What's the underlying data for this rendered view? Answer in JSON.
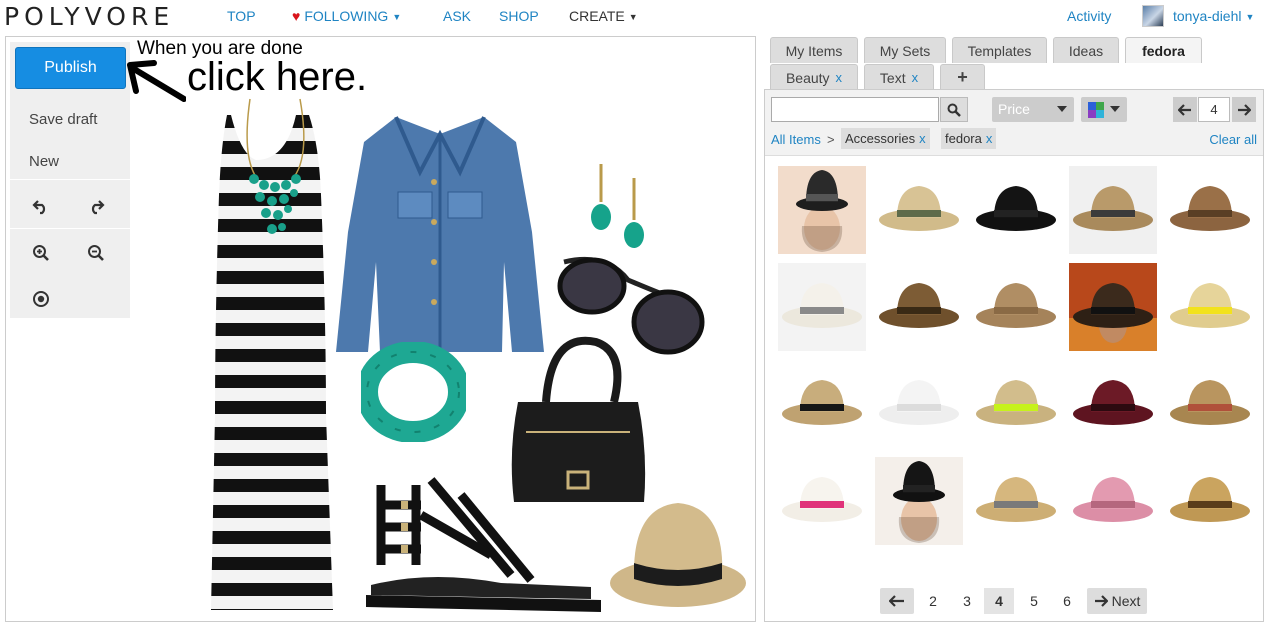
{
  "nav": {
    "logo": "POLYVORE",
    "items": [
      {
        "label": "TOP"
      },
      {
        "label": "FOLLOWING"
      },
      {
        "label": "ASK"
      },
      {
        "label": "SHOP"
      },
      {
        "label": "CREATE"
      }
    ],
    "activity": "Activity",
    "username": "tonya-diehl",
    "colors": {
      "link": "#1f84c3",
      "heart": "#d9141b"
    }
  },
  "toolbox": {
    "publish": "Publish",
    "save_draft": "Save draft",
    "new": "New",
    "icons": [
      "undo-icon",
      "redo-icon",
      "zoom-in-icon",
      "zoom-out-icon",
      "target-icon"
    ]
  },
  "hint": {
    "small": "When you are done",
    "big": "click here."
  },
  "canvas_items": [
    "striped-maxi-dress",
    "statement-necklace",
    "denim-jacket",
    "turquoise-earrings",
    "aviator-sunglasses",
    "turquoise-bracelet",
    "black-leather-bag",
    "black-gladiator-sandals",
    "straw-fedora"
  ],
  "tabs": {
    "row1": [
      {
        "label": "My Items"
      },
      {
        "label": "My Sets"
      },
      {
        "label": "Templates"
      },
      {
        "label": "Ideas"
      },
      {
        "label": "fedora",
        "active": true
      }
    ],
    "row2": [
      {
        "label": "Beauty",
        "close": "x"
      },
      {
        "label": "Text",
        "close": "x"
      },
      {
        "label": "+"
      }
    ]
  },
  "search": {
    "value": "",
    "price_label": "Price",
    "page_value": "4"
  },
  "breadcrumb": {
    "all": "All Items",
    "sep": ">",
    "chip1": "Accessories",
    "chip2": "fedora",
    "chip_close": "x",
    "clear": "Clear all"
  },
  "results": [
    "fedora-on-model",
    "straw-fedora-green-band",
    "black-wool-fedora",
    "tan-fedora",
    "brown-fedora",
    "white-fedora",
    "small-brown-fedora",
    "woven-straw-fedora",
    "indiana-jones-poster",
    "yellow-band-straw-fedora",
    "straw-fedora-black-band",
    "white-ribbed-fedora",
    "neon-band-straw-fedora",
    "burgundy-wide-brim-hat",
    "patterned-band-fedora",
    "white-pink-band-panama",
    "black-hat-on-model",
    "straw-gray-band-fedora",
    "pink-floppy-hat",
    "natural-straw-fedora"
  ],
  "pager": {
    "prev": "",
    "pages": [
      "2",
      "3",
      "4",
      "5",
      "6"
    ],
    "current": "4",
    "next": "Next"
  }
}
